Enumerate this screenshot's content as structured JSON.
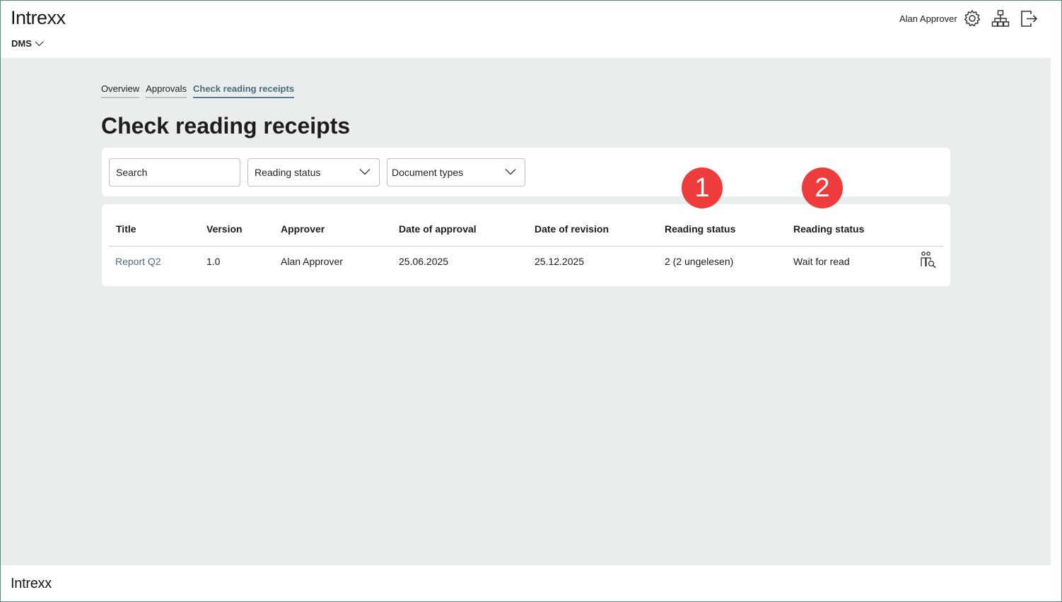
{
  "header": {
    "logo": "Intrexx",
    "app_menu": "DMS",
    "user_name": "Alan Approver",
    "icons": [
      "gear-icon",
      "sitemap-icon",
      "logout-icon"
    ]
  },
  "tabs": [
    {
      "label": "Overview",
      "active": false
    },
    {
      "label": "Approvals",
      "active": false
    },
    {
      "label": "Check reading receipts",
      "active": true
    }
  ],
  "page_title": "Check reading receipts",
  "filters": {
    "search_placeholder": "Search",
    "reading_status": "Reading status",
    "document_types": "Document types"
  },
  "table": {
    "columns": [
      "Title",
      "Version",
      "Approver",
      "Date of approval",
      "Date of revision",
      "Reading status",
      "Reading status"
    ],
    "rows": [
      {
        "title": "Report Q2",
        "version": "1.0",
        "approver": "Alan Approver",
        "date_of_approval": "25.06.2025",
        "date_of_revision": "25.12.2025",
        "reading_count": "2 (2 ungelesen)",
        "reading_status": "Wait for read",
        "action_icon": "users-search-icon"
      }
    ]
  },
  "annotations": {
    "badge1": "1",
    "badge2": "2",
    "color": "#ee3b3b"
  },
  "footer": {
    "logo": "Intrexx"
  }
}
